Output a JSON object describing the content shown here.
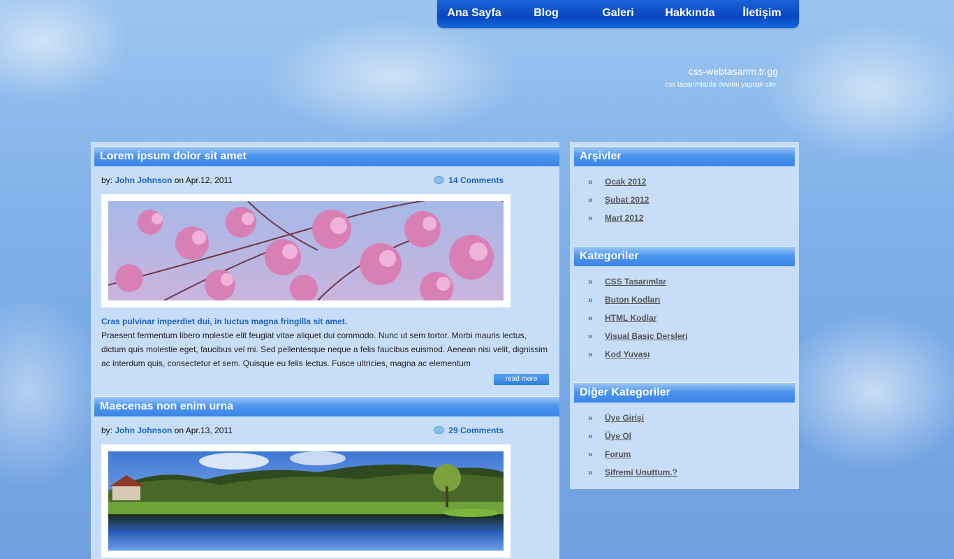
{
  "nav": {
    "items": [
      {
        "label": "Ana Sayfa"
      },
      {
        "label": "Blog"
      },
      {
        "label": "Galeri"
      },
      {
        "label": "Hakkında"
      },
      {
        "label": "İletişim"
      }
    ]
  },
  "brand": {
    "title": "css-webtasarim.tr.gg",
    "tagline": "css tasarımlarda devrim yapcak site."
  },
  "posts": [
    {
      "title": "Lorem ipsum dolor sit amet",
      "by_label": "by:",
      "author": "John Johnson",
      "on_label": "on",
      "date": "Apr.12, 2011",
      "comments": "14 Comments",
      "lead": "Cras pulvinar imperdiet dui, in luctus magna fringilla sit amet.",
      "body": "Praesent fermentum libero molestie elit feugiat vitae aliquet dui commodo. Nunc ut sem tortor. Morbi mauris lectus, dictum quis molestie eget, faucibus vel mi. Sed pellentesque neque a felis faucibus euismod. Aenean nisi velit, dignissim ac interdum quis, consectetur et sem. Quisque eu felis lectus. Fusce ultricies, magna ac elementum",
      "read_more": "read more"
    },
    {
      "title": "Maecenas non enim urna",
      "by_label": "by:",
      "author": "John Johnson",
      "on_label": "on",
      "date": "Apr.13, 2011",
      "comments": "29 Comments"
    }
  ],
  "sidebar": {
    "sections": [
      {
        "title": "Arşivler",
        "items": [
          "Ocak 2012",
          "Şubat 2012",
          "Mart 2012"
        ]
      },
      {
        "title": "Kategoriler",
        "items": [
          "CSS Tasarımlar",
          "Buton Kodları",
          "HTML Kodlar",
          "Visual Basic Dersleri",
          "Kod Yuvası"
        ]
      },
      {
        "title": "Diğer Kategoriler",
        "items": [
          "Üye Girişi",
          "Üye Ol",
          "Forum",
          "Şifremi Unuttum.?"
        ]
      }
    ]
  },
  "colors": {
    "link": "#1a63c9",
    "panel": "#c8def8",
    "nav": "#0a47c0"
  }
}
